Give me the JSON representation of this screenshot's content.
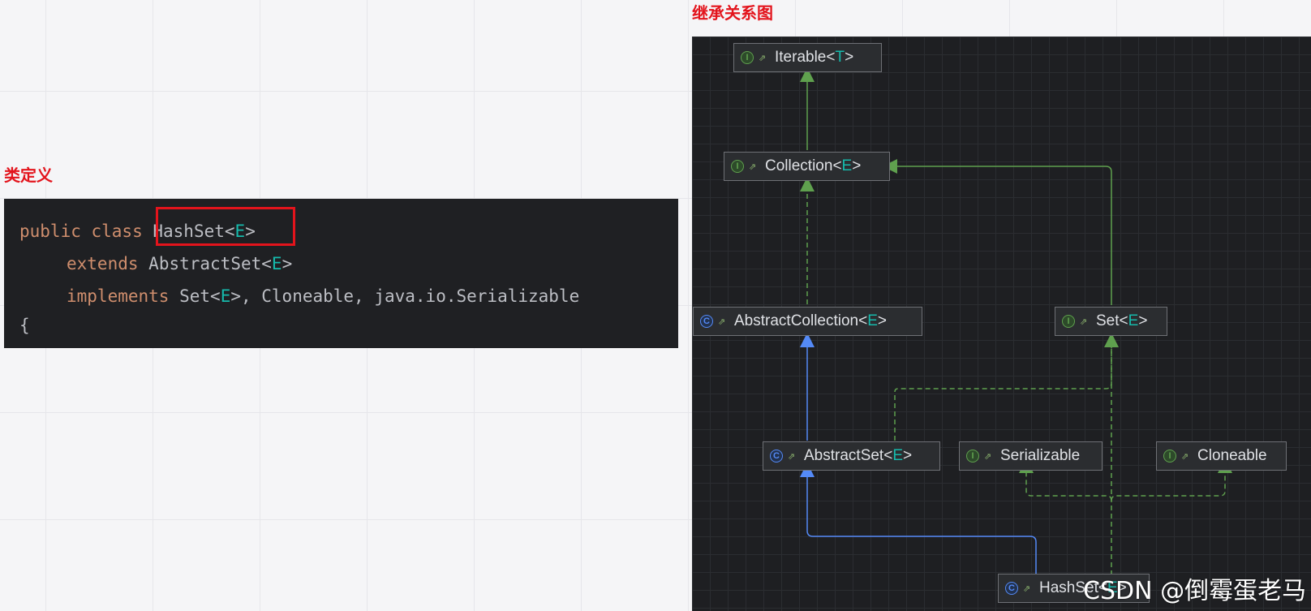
{
  "labels": {
    "class_definition": "类定义",
    "inheritance_diagram": "继承关系图"
  },
  "code": {
    "line1": {
      "kw": "public class",
      "name": "HashSet",
      "lt": "<",
      "param": "E",
      "gt": ">"
    },
    "line2": {
      "kw": "extends",
      "name": "AbstractSet",
      "lt": "<",
      "param": "E",
      "gt": ">"
    },
    "line3": {
      "kw": "implements",
      "name": "Set",
      "lt": "<",
      "param": "E",
      "rest": ">, Cloneable, java.io.Serializable"
    },
    "line4": "{"
  },
  "nodes": {
    "iterable": {
      "name": "Iterable",
      "param": "T",
      "kind": "I"
    },
    "collection": {
      "name": "Collection",
      "param": "E",
      "kind": "I"
    },
    "abstract_collection": {
      "name": "AbstractCollection",
      "param": "E",
      "kind": "C"
    },
    "set": {
      "name": "Set",
      "param": "E",
      "kind": "I"
    },
    "abstract_set": {
      "name": "AbstractSet",
      "param": "E",
      "kind": "C"
    },
    "serializable": {
      "name": "Serializable",
      "kind": "I"
    },
    "cloneable": {
      "name": "Cloneable",
      "kind": "I"
    },
    "hashset": {
      "name": "HashSet",
      "param": "E",
      "kind": "C"
    }
  },
  "colors": {
    "extends_interface": "#5fa04e",
    "extends_class": "#548af7",
    "highlight": "#e3141c"
  },
  "watermark": "CSDN @倒霉蛋老马"
}
